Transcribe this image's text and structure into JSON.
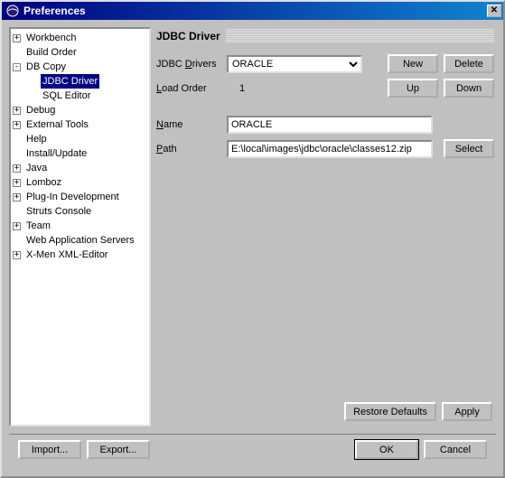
{
  "window": {
    "title": "Preferences"
  },
  "tree": {
    "items": [
      {
        "label": "Workbench",
        "toggle": "+"
      },
      {
        "label": "Build Order"
      },
      {
        "label": "DB Copy",
        "toggle": "-",
        "children": [
          {
            "label": "JDBC Driver",
            "selected": true
          },
          {
            "label": "SQL Editor"
          }
        ]
      },
      {
        "label": "Debug",
        "toggle": "+"
      },
      {
        "label": "External Tools",
        "toggle": "+"
      },
      {
        "label": "Help"
      },
      {
        "label": "Install/Update"
      },
      {
        "label": "Java",
        "toggle": "+"
      },
      {
        "label": "Lomboz",
        "toggle": "+"
      },
      {
        "label": "Plug-In Development",
        "toggle": "+"
      },
      {
        "label": "Struts Console"
      },
      {
        "label": "Team",
        "toggle": "+"
      },
      {
        "label": "Web Application Servers"
      },
      {
        "label": "X-Men XML-Editor",
        "toggle": "+"
      }
    ]
  },
  "panel": {
    "title": "JDBC Driver",
    "labels": {
      "drivers_pre": "JDBC ",
      "drivers_u": "D",
      "drivers_post": "rivers",
      "load_pre": "",
      "load_u": "L",
      "load_post": "oad Order",
      "name_u": "N",
      "name_post": "ame",
      "path_u": "P",
      "path_post": "ath"
    },
    "drivers_value": "ORACLE",
    "load_order": "1",
    "name_value": "ORACLE",
    "path_value": "E:\\local\\images\\jdbc\\oracle\\classes12.zip",
    "buttons": {
      "new": "New",
      "delete": "Delete",
      "up": "Up",
      "down": "Down",
      "select": "Select",
      "restore": "Restore Defaults",
      "apply": "Apply"
    }
  },
  "dialog_buttons": {
    "import": "Import...",
    "export": "Export...",
    "ok": "OK",
    "cancel": "Cancel"
  }
}
